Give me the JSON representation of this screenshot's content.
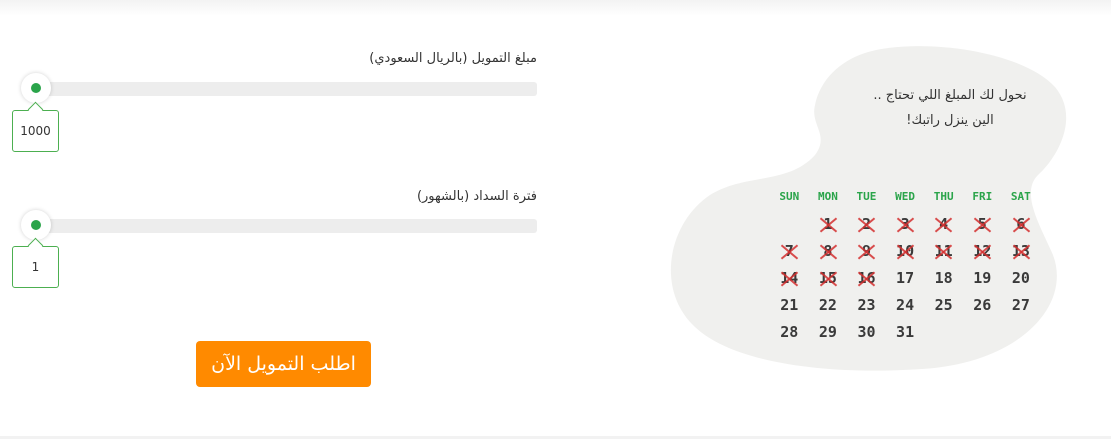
{
  "amount_field": {
    "label": "مبلغ التمويل (بالريال السعودي)",
    "value": "1000",
    "slider_fraction": 0.0
  },
  "period_field": {
    "label": "فترة السداد (بالشهور)",
    "value": "1",
    "slider_fraction": 0.0
  },
  "cta": {
    "label": "اطلب التمويل الآن"
  },
  "promo": {
    "line1": "نحول لك المبلغ اللي تحتاج ..",
    "line2": "الين ينزل راتبك!"
  },
  "calendar": {
    "weekdays": [
      "SUN",
      "MON",
      "TUE",
      "WED",
      "THU",
      "FRI",
      "SAT"
    ],
    "weeks": [
      [
        "",
        "1",
        "2",
        "3",
        "4",
        "5",
        "6"
      ],
      [
        "7",
        "8",
        "9",
        "10",
        "11",
        "12",
        "13"
      ],
      [
        "14",
        "15",
        "16",
        "17",
        "18",
        "19",
        "20"
      ],
      [
        "21",
        "22",
        "23",
        "24",
        "25",
        "26",
        "27"
      ],
      [
        "28",
        "29",
        "30",
        "31",
        "",
        "",
        ""
      ]
    ],
    "crossed_out_days": [
      "1",
      "2",
      "3",
      "4",
      "5",
      "6",
      "7",
      "8",
      "9",
      "10",
      "11",
      "12",
      "13",
      "14",
      "15",
      "16"
    ]
  },
  "colors": {
    "accent_green": "#2aa44a",
    "cta_orange": "#ff8a00",
    "cross_red": "#d32f2f",
    "blob_gray": "#f0f0ee"
  }
}
